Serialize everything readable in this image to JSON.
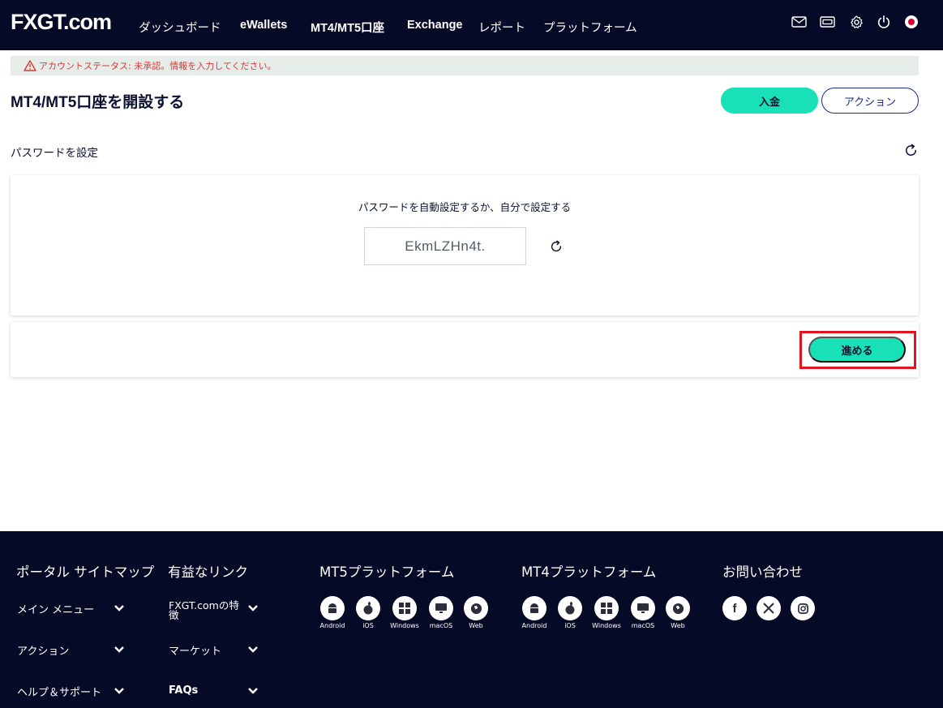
{
  "header": {
    "logo": "FXGT.com",
    "nav": [
      {
        "label": "ダッシュボード"
      },
      {
        "label": "eWallets"
      },
      {
        "label": "MT4/MT5口座"
      },
      {
        "label": "Exchange"
      },
      {
        "label": "レポート"
      },
      {
        "label": "プラットフォーム"
      }
    ],
    "icons": [
      "mail-icon",
      "wallet-icon",
      "gear-icon",
      "power-icon",
      "japan-flag-icon"
    ]
  },
  "alert": {
    "text": "アカウントステータス: 未承認。情報を入力してください。",
    "color": "#d23a3a"
  },
  "page": {
    "title": "MT4/MT5口座を開設する",
    "deposit_label": "入金",
    "action_label": "アクション",
    "section_label": "パスワードを設定"
  },
  "password_card": {
    "instruction": "パスワードを自動設定するか、自分で設定する",
    "password_value": "EkmLZHn4t.",
    "proceed_label": "進める"
  },
  "colors": {
    "accent": "#18e0b7",
    "navy": "#050b26",
    "highlight": "#e3151c"
  },
  "footer": {
    "portal": {
      "heading": "ポータル サイトマップ",
      "links": [
        "メイン メニュー",
        "アクション",
        "ヘルプ＆サポート"
      ]
    },
    "useful": {
      "heading": "有益なリンク",
      "links": [
        "FXGT.comの特徴",
        "マーケット",
        "FAQs"
      ]
    },
    "mt5": {
      "heading": "MT5プラットフォーム",
      "platforms": [
        "Android",
        "iOS",
        "Windows",
        "macOS",
        "Web"
      ]
    },
    "mt4": {
      "heading": "MT4プラットフォーム",
      "platforms": [
        "Android",
        "iOS",
        "Windows",
        "macOS",
        "Web"
      ]
    },
    "contact": {
      "heading": "お問い合わせ",
      "socials": [
        "facebook-icon",
        "x-icon",
        "instagram-icon"
      ]
    }
  }
}
